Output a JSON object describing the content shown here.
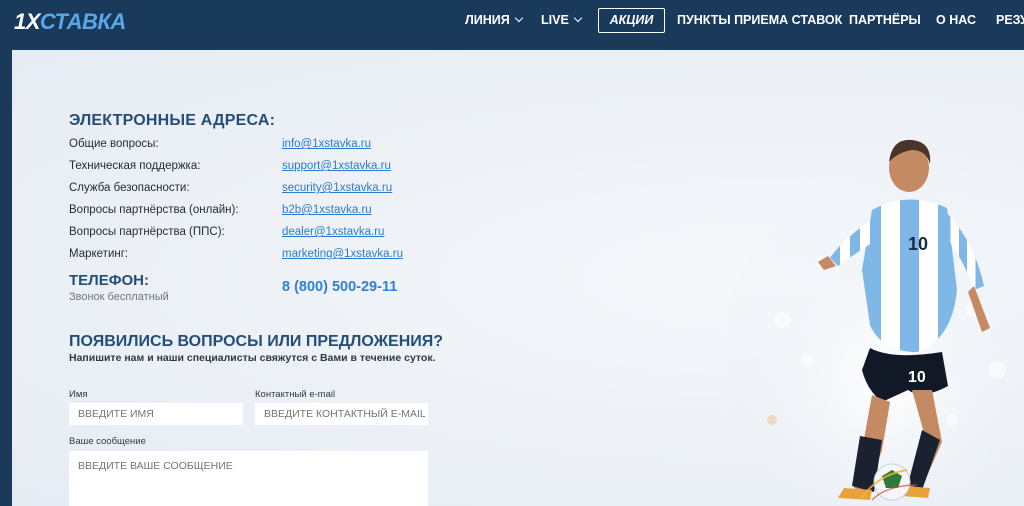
{
  "brand": {
    "logo_prefix": "1X",
    "logo_suffix": "СТАВКА"
  },
  "nav": {
    "items": [
      {
        "label": "ЛИНИЯ",
        "has_dropdown": true
      },
      {
        "label": "LIVE",
        "has_dropdown": true
      },
      {
        "label": "АКЦИИ",
        "boxed": true
      },
      {
        "label": "ПУНКТЫ ПРИЕМА СТАВОК"
      },
      {
        "label": "ПАРТНЁРЫ"
      },
      {
        "label": "О НАС"
      },
      {
        "label": "РЕЗУ"
      }
    ]
  },
  "emails": {
    "title": "ЭЛЕКТРОННЫЕ АДРЕСА:",
    "rows": [
      {
        "label": "Общие вопросы:",
        "email": "info@1xstavka.ru"
      },
      {
        "label": "Техническая поддержка:",
        "email": "support@1xstavka.ru"
      },
      {
        "label": "Служба безопасности:",
        "email": "security@1xstavka.ru"
      },
      {
        "label": "Вопросы партнёрства (онлайн):",
        "email": "b2b@1xstavka.ru"
      },
      {
        "label": "Вопросы партнёрства (ППС):",
        "email": "dealer@1xstavka.ru"
      },
      {
        "label": "Маркетинг:",
        "email": "marketing@1xstavka.ru"
      }
    ]
  },
  "phone": {
    "title": "ТЕЛЕФОН:",
    "subtitle": "Звонок бесплатный",
    "number": "8 (800) 500-29-11"
  },
  "feedback": {
    "title": "ПОЯВИЛИСЬ ВОПРОСЫ ИЛИ ПРЕДЛОЖЕНИЯ?",
    "subtitle": "Напишите нам и наши специалисты свяжутся с Вами в течение суток.",
    "name_label": "Имя",
    "name_placeholder": "ВВЕДИТЕ ИМЯ",
    "email_label": "Контактный e-mail",
    "email_placeholder": "ВВЕДИТЕ КОНТАКТНЫЙ E-MAIL",
    "message_label": "Ваше сообщение",
    "message_placeholder": "ВВЕДИТЕ ВАШЕ СООБЩЕНИЕ"
  },
  "colors": {
    "header_bg": "#1a3a5c",
    "title_blue": "#244e7a",
    "link_blue": "#2a7bd0",
    "accent_blue": "#5aa7e8"
  },
  "illustration": {
    "jersey_number": "10"
  }
}
